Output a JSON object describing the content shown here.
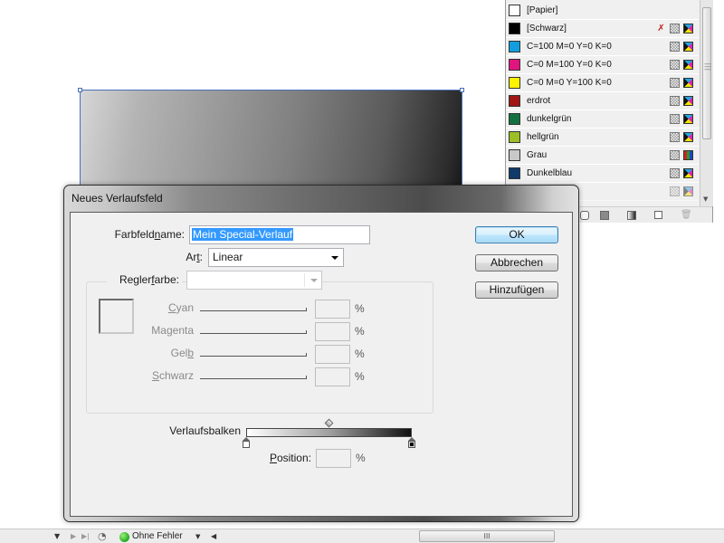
{
  "swatches_panel": {
    "items": [
      {
        "name": "[Papier]",
        "color": "#ffffff",
        "icons": []
      },
      {
        "name": "[Schwarz]",
        "color": "#000000",
        "icons": [
          "no-edit",
          "tint",
          "cmyk"
        ]
      },
      {
        "name": "C=100 M=0 Y=0 K=0",
        "color": "#109ee0",
        "icons": [
          "tint",
          "cmyk"
        ]
      },
      {
        "name": "C=0 M=100 Y=0 K=0",
        "color": "#e0157f",
        "icons": [
          "tint",
          "cmyk"
        ]
      },
      {
        "name": "C=0 M=0 Y=100 K=0",
        "color": "#fff200",
        "icons": [
          "tint",
          "cmyk"
        ]
      },
      {
        "name": "erdrot",
        "color": "#a01515",
        "icons": [
          "tint",
          "cmyk"
        ]
      },
      {
        "name": "dunkelgrün",
        "color": "#137040",
        "icons": [
          "tint",
          "cmyk"
        ]
      },
      {
        "name": "hellgrün",
        "color": "#9bbf25",
        "icons": [
          "tint",
          "cmyk"
        ]
      },
      {
        "name": "Grau",
        "color": "#c8c8c8",
        "icons": [
          "tint",
          "rgb"
        ]
      },
      {
        "name": "Dunkelblau",
        "color": "#103a6a",
        "icons": [
          "tint",
          "cmyk"
        ]
      },
      {
        "name": "",
        "color": "#e8e4c8",
        "icons": [
          "tint",
          "cmyk"
        ]
      }
    ],
    "footer_icons": [
      "show-all-swatches-icon",
      "show-color-swatches-icon",
      "show-gradient-swatches-icon",
      "new-swatch-icon",
      "delete-swatch-icon"
    ]
  },
  "status_bar": {
    "preflight_status": "Ohne Fehler",
    "scroll_grip": "III"
  },
  "dialog": {
    "title": "Neues Verlaufsfeld",
    "swatch_name_label_pre": "Farbfeld",
    "swatch_name_label_u": "n",
    "swatch_name_label_post": "ame:",
    "swatch_name_value": "Mein Special-Verlauf",
    "type_label_pre": "Ar",
    "type_label_u": "t",
    "type_label_post": ":",
    "type_value": "Linear",
    "stop_color_label_pre": "Regler",
    "stop_color_label_u": "f",
    "stop_color_label_post": "arbe:",
    "stop_color_value": "",
    "channels": [
      {
        "pre": "",
        "u": "C",
        "post": "yan",
        "value": ""
      },
      {
        "pre": "Ma",
        "u": "g",
        "post": "enta",
        "value": ""
      },
      {
        "pre": "Gel",
        "u": "b",
        "post": "",
        "value": ""
      },
      {
        "pre": "",
        "u": "S",
        "post": "chwarz",
        "value": ""
      }
    ],
    "percent_sign": "%",
    "gradient_ramp_label": "Verlaufsbalken",
    "gradient_ramp": {
      "stops": [
        {
          "color": "#ffffff",
          "location_pct": 0
        },
        {
          "color": "#000000",
          "location_pct": 100
        }
      ],
      "midpoint_pct": 50
    },
    "position_label_u": "P",
    "position_label_post": "osition:",
    "position_value": "",
    "buttons": {
      "ok": "OK",
      "cancel": "Abbrechen",
      "add": "Hinzufügen"
    }
  }
}
